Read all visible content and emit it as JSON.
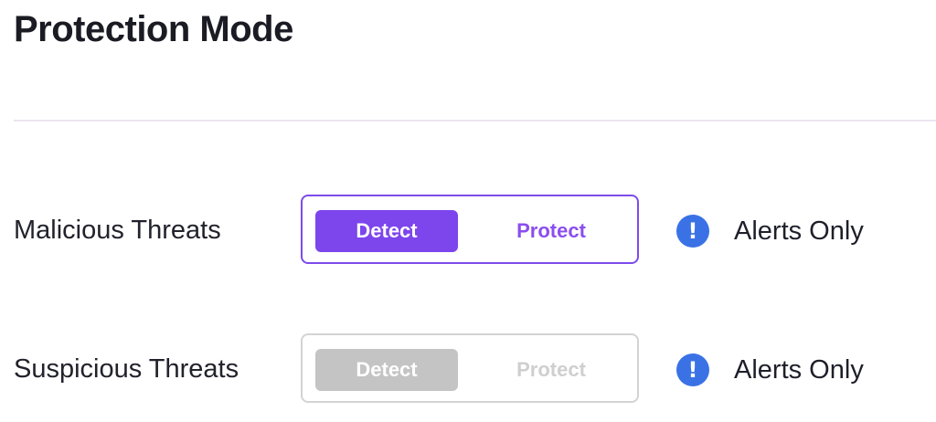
{
  "page": {
    "title": "Protection Mode"
  },
  "rows": [
    {
      "label": "Malicious Threats",
      "options": [
        "Detect",
        "Protect"
      ],
      "selected": "Detect",
      "enabled": true,
      "status_icon": "info-icon",
      "status_text": "Alerts Only"
    },
    {
      "label": "Suspicious Threats",
      "options": [
        "Detect",
        "Protect"
      ],
      "selected": "Detect",
      "enabled": false,
      "status_icon": "info-icon",
      "status_text": "Alerts Only"
    }
  ],
  "colors": {
    "accent": "#7d45ec",
    "info": "#3a72e6",
    "disabled": "#c4c4c4",
    "divider": "#ece4f2"
  }
}
